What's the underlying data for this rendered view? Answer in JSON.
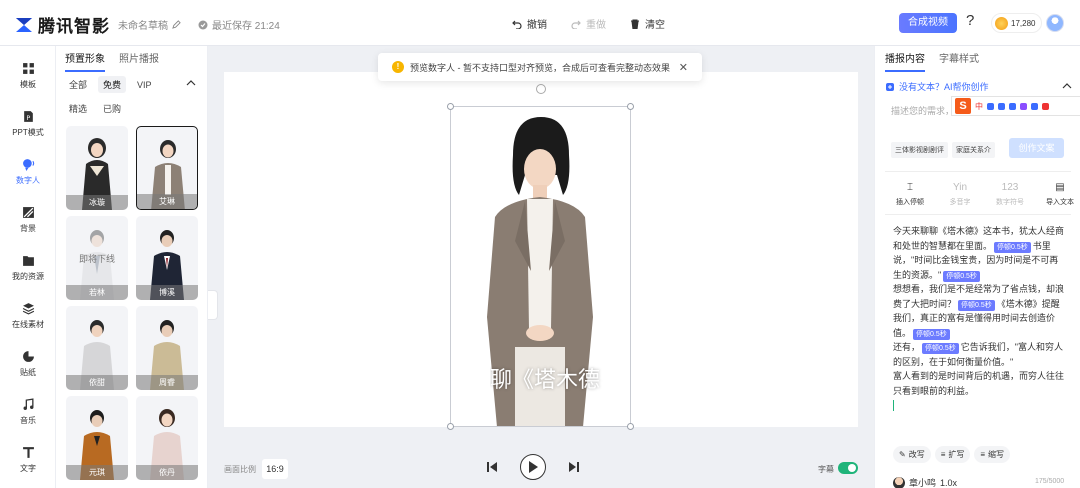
{
  "header": {
    "brand": "腾讯智影",
    "draft_name": "未命名草稿",
    "save_status": "最近保存 21:24",
    "undo": "撤销",
    "redo": "重做",
    "clear": "清空",
    "compose": "合成视频",
    "help": "?",
    "coins": "17,280"
  },
  "rail": [
    {
      "label": "模板",
      "icon": "template-icon"
    },
    {
      "label": "PPT模式",
      "icon": "ppt-icon"
    },
    {
      "label": "数字人",
      "icon": "digital-human-icon"
    },
    {
      "label": "背景",
      "icon": "background-icon"
    },
    {
      "label": "我的资源",
      "icon": "folder-icon"
    },
    {
      "label": "在线素材",
      "icon": "layers-icon"
    },
    {
      "label": "贴纸",
      "icon": "sticker-icon"
    },
    {
      "label": "音乐",
      "icon": "music-icon"
    },
    {
      "label": "文字",
      "icon": "text-icon"
    }
  ],
  "panel": {
    "tabs": [
      "预置形象",
      "照片播报"
    ],
    "filters": [
      "全部",
      "免费",
      "VIP"
    ],
    "filters2": [
      "精选",
      "已购"
    ],
    "avatars": [
      {
        "name": "冰璇",
        "offline": ""
      },
      {
        "name": "艾琳",
        "offline": ""
      },
      {
        "name": "若林",
        "offline": "即将下线"
      },
      {
        "name": "博溪",
        "offline": ""
      },
      {
        "name": "依甜",
        "offline": ""
      },
      {
        "name": "周睿",
        "offline": ""
      },
      {
        "name": "元琪",
        "offline": ""
      },
      {
        "name": "依丹",
        "offline": ""
      }
    ]
  },
  "canvas": {
    "notice": "预览数字人 - 暂不支持口型对齐预览，合成后可查看完整动态效果",
    "subtitle": "聊《塔木德",
    "ratio_label": "画面比例",
    "ratio": "16:9",
    "subtitle_toggle_label": "字幕"
  },
  "right": {
    "tabs": [
      "播报内容",
      "字幕样式"
    ],
    "ai_link": "没有文本？AI帮你创作",
    "prompt_placeholder": "描述您的需求，",
    "chips": [
      "三体影视剧剧评",
      "家庭关系介"
    ],
    "create_btn": "创作文案",
    "tools": [
      "插入停顿",
      "多音字",
      "数字符号",
      "导入文本"
    ],
    "tool_glyphs": [
      "⌶",
      "Yin",
      "123",
      "▤"
    ],
    "script": {
      "p1a": "今天来聊聊《塔木德》这本书，犹太人经商和处世的智慧都在里面。",
      "pause": "停顿0.5秒",
      "p1b": "书里说，\"时间比金钱宝贵，因为时间是不可再生的资源。\"",
      "p2a": "想想看，我们是不是经常为了省点钱，却浪费了大把时间？",
      "p2b": "《塔木德》提醒我们，真正的富有是懂得用时间去创造价值。",
      "p3a": "还有，",
      "p3b": "它告诉我们，\"富人和穷人的区别，在于如何衡量价值。\"",
      "p4": "富人看到的是时间背后的机遇，而穷人往往只看到眼前的利益。"
    },
    "rewrite": [
      "改写",
      "扩写",
      "缩写"
    ],
    "voice_name": "章小鸣",
    "voice_speed": "1.0x",
    "char_count": "175/5000"
  },
  "colors": {
    "accent": "#3b6cff",
    "pause_tag": "#6c7bff",
    "toggle_on": "#1fb47a"
  }
}
